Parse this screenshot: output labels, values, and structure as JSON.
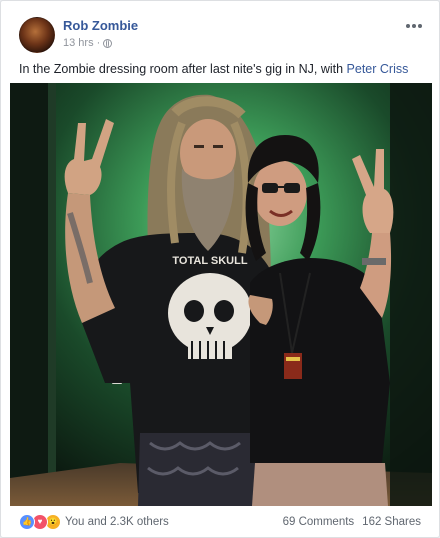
{
  "post": {
    "author": "Rob Zombie",
    "time": "13 hrs",
    "time_separator": "·",
    "caption_text": "In the Zombie dressing room after last nite's gig in NJ, with ",
    "caption_link": "Peter Criss"
  },
  "photo": {
    "shirt_text": "TOTAL SKULL"
  },
  "footer": {
    "reaction_summary": "You and 2.3K others",
    "comments": "69 Comments",
    "shares": "162 Shares"
  },
  "colors": {
    "link": "#365899",
    "meta": "#90949c",
    "like": "#5890ff",
    "love": "#f25268",
    "wow": "#f7b125"
  },
  "icons": [
    "globe-icon",
    "more-options-icon",
    "like-reaction-icon",
    "love-reaction-icon",
    "wow-reaction-icon"
  ]
}
